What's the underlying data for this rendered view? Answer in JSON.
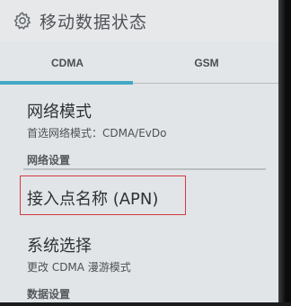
{
  "header": {
    "icon": "gear-icon",
    "title": "移动数据状态"
  },
  "tabs": [
    {
      "label": "CDMA",
      "selected": true
    },
    {
      "label": "GSM",
      "selected": false
    }
  ],
  "accent_color": "#41a9c6",
  "highlight_color": "#d23a3f",
  "list": {
    "network_mode": {
      "title": "网络模式",
      "summary": "首选网络模式：CDMA/EvDo"
    },
    "network_settings_header": "网络设置",
    "apn": {
      "title": "接入点名称 (APN)",
      "highlighted": true
    },
    "system_select": {
      "title": "系统选择",
      "summary": "更改 CDMA 漫游模式"
    },
    "data_settings_header": "数据设置"
  }
}
